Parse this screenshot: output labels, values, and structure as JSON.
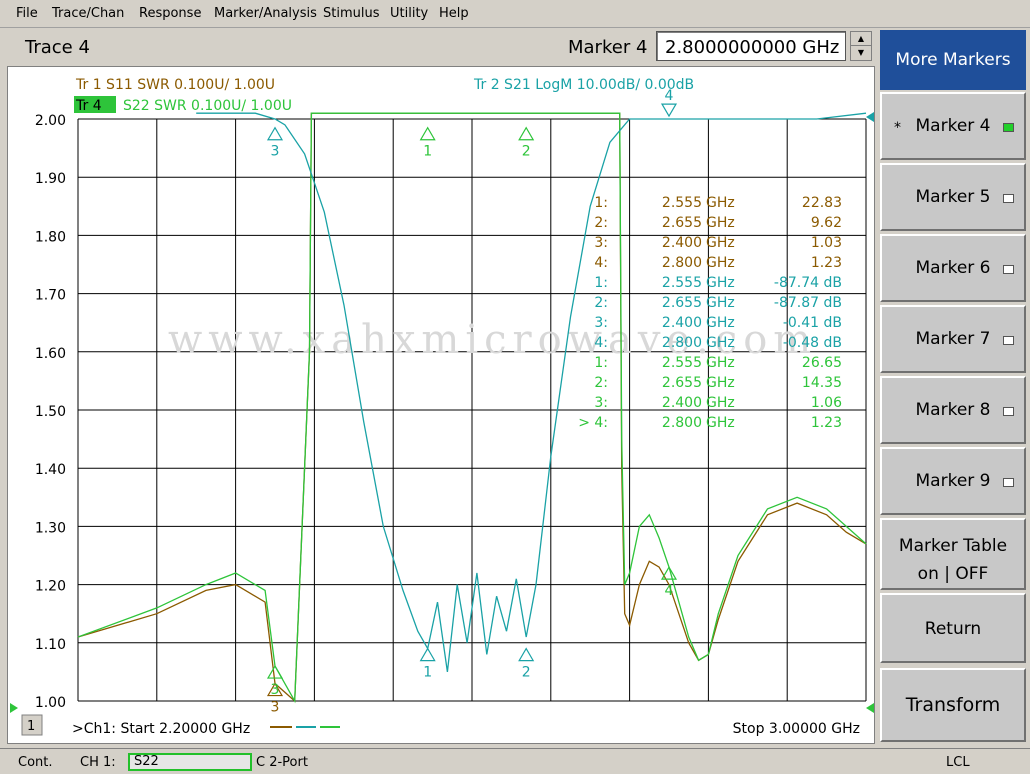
{
  "menu": [
    "File",
    "Trace/Chan",
    "Response",
    "Marker/Analysis",
    "Stimulus",
    "Utility",
    "Help"
  ],
  "header": {
    "trace_title": "Trace 4",
    "marker_label": "Marker 4",
    "marker_value": "2.8000000000 GHz"
  },
  "colors": {
    "s11": "#8b5a00",
    "s21": "#1aa2a6",
    "s22": "#2ec43a",
    "grid": "#000000",
    "active_softkey": "#1f4f9a"
  },
  "trace_labels": {
    "tr1": "Tr  1   S11 SWR 0.100U/  1.00U",
    "tr2": "Tr  2   S21 LogM 10.00dB/  0.00dB",
    "tr4_badge": "Tr  4",
    "tr4_text": "S22 SWR 0.100U/  1.00U"
  },
  "footer": {
    "channel_badge": "1",
    "start": ">Ch1: Start  2.20000 GHz",
    "stop": "Stop  3.00000 GHz"
  },
  "softkeys": [
    {
      "label": "More Markers",
      "active": true
    },
    {
      "label": "Marker 4",
      "star": "*",
      "led": "on"
    },
    {
      "label": "Marker 5",
      "led": "off"
    },
    {
      "label": "Marker 6",
      "led": "off"
    },
    {
      "label": "Marker 7",
      "led": "off"
    },
    {
      "label": "Marker 8",
      "led": "off"
    },
    {
      "label": "Marker 9",
      "led": "off"
    },
    {
      "label": "Marker Table",
      "label2": "on | OFF"
    },
    {
      "label": "Return"
    },
    {
      "label": "Transform"
    }
  ],
  "status": {
    "mode": "Cont.",
    "channel": "CH 1:",
    "param": "S22",
    "cal": "C  2-Port",
    "remote": "LCL"
  },
  "watermark": "www.xahxmicrowave.com",
  "chart_data": {
    "type": "line",
    "x_unit": "GHz",
    "xlim": [
      2.2,
      3.0
    ],
    "ylim": [
      1.0,
      2.0
    ],
    "y_ticks": [
      "2.00",
      "1.90",
      "1.80",
      "1.70",
      "1.60",
      "1.50",
      "1.40",
      "1.30",
      "1.20",
      "1.10",
      "1.00"
    ],
    "grid": true,
    "series": [
      {
        "key": "s11",
        "x": [
          2.2,
          2.28,
          2.33,
          2.36,
          2.39,
          2.4,
          2.42,
          2.435,
          2.437,
          2.75,
          2.752,
          2.755,
          2.76,
          2.77,
          2.78,
          2.79,
          2.8,
          2.82,
          2.83,
          2.84,
          2.85,
          2.87,
          2.9,
          2.93,
          2.96,
          2.98,
          3.0
        ],
        "y": [
          1.11,
          1.15,
          1.19,
          1.2,
          1.17,
          1.03,
          1.0,
          1.6,
          2.01,
          2.01,
          1.4,
          1.15,
          1.13,
          1.2,
          1.24,
          1.23,
          1.2,
          1.1,
          1.07,
          1.08,
          1.14,
          1.24,
          1.32,
          1.34,
          1.32,
          1.29,
          1.27
        ]
      },
      {
        "key": "s22",
        "x": [
          2.2,
          2.28,
          2.33,
          2.36,
          2.39,
          2.4,
          2.42,
          2.435,
          2.437,
          2.75,
          2.752,
          2.755,
          2.76,
          2.77,
          2.78,
          2.79,
          2.8,
          2.82,
          2.83,
          2.84,
          2.85,
          2.87,
          2.9,
          2.93,
          2.96,
          2.98,
          3.0
        ],
        "y": [
          1.11,
          1.16,
          1.2,
          1.22,
          1.19,
          1.06,
          1.0,
          1.6,
          2.01,
          2.01,
          1.45,
          1.2,
          1.22,
          1.3,
          1.32,
          1.28,
          1.23,
          1.11,
          1.07,
          1.08,
          1.15,
          1.25,
          1.33,
          1.35,
          1.33,
          1.3,
          1.27
        ]
      },
      {
        "key": "s21",
        "x": [
          2.32,
          2.35,
          2.38,
          2.4,
          2.41,
          2.43,
          2.45,
          2.47,
          2.49,
          2.51,
          2.53,
          2.545,
          2.555,
          2.565,
          2.575,
          2.585,
          2.595,
          2.605,
          2.615,
          2.625,
          2.635,
          2.645,
          2.655,
          2.665,
          2.68,
          2.7,
          2.72,
          2.74,
          2.76,
          2.78,
          2.8,
          2.85,
          2.9,
          2.95,
          3.0
        ],
        "y": [
          2.01,
          2.01,
          2.01,
          2.0,
          1.99,
          1.94,
          1.84,
          1.68,
          1.48,
          1.3,
          1.19,
          1.12,
          1.09,
          1.17,
          1.05,
          1.2,
          1.1,
          1.22,
          1.08,
          1.18,
          1.12,
          1.21,
          1.11,
          1.2,
          1.42,
          1.66,
          1.85,
          1.96,
          2.0,
          2.0,
          2.0,
          2.0,
          2.0,
          2.0,
          2.01
        ]
      }
    ],
    "markers_on_chart": [
      {
        "label": "3",
        "x": 2.4,
        "y": 1.985,
        "series": "s21"
      },
      {
        "label": "1",
        "x": 2.555,
        "y": 1.985,
        "series": "s22"
      },
      {
        "label": "2",
        "x": 2.655,
        "y": 1.985,
        "series": "s22"
      },
      {
        "label": "4",
        "x": 2.8,
        "y": 2.005,
        "series": "s21",
        "point_down": true
      },
      {
        "label": "3",
        "x": 2.4,
        "y": 1.03,
        "series": "s11"
      },
      {
        "label": "3",
        "x": 2.4,
        "y": 1.06,
        "series": "s22"
      },
      {
        "label": "1",
        "x": 2.555,
        "y": 1.09,
        "series": "s21"
      },
      {
        "label": "2",
        "x": 2.655,
        "y": 1.09,
        "series": "s21"
      },
      {
        "label": "4",
        "x": 2.8,
        "y": 1.23,
        "series": "s22"
      }
    ],
    "marker_table": [
      {
        "num": "1:",
        "freq": "2.555",
        "unit": "GHz",
        "value": "22.83",
        "series": "s11"
      },
      {
        "num": "2:",
        "freq": "2.655",
        "unit": "GHz",
        "value": "9.62",
        "series": "s11"
      },
      {
        "num": "3:",
        "freq": "2.400",
        "unit": "GHz",
        "value": "1.03",
        "series": "s11"
      },
      {
        "num": "4:",
        "freq": "2.800",
        "unit": "GHz",
        "value": "1.23",
        "series": "s11"
      },
      {
        "num": "1:",
        "freq": "2.555",
        "unit": "GHz",
        "value": "-87.74 dB",
        "series": "s21"
      },
      {
        "num": "2:",
        "freq": "2.655",
        "unit": "GHz",
        "value": "-87.87 dB",
        "series": "s21"
      },
      {
        "num": "3:",
        "freq": "2.400",
        "unit": "GHz",
        "value": "-0.41 dB",
        "series": "s21"
      },
      {
        "num": "4:",
        "freq": "2.800",
        "unit": "GHz",
        "value": "-0.48 dB",
        "series": "s21"
      },
      {
        "num": "1:",
        "freq": "2.555",
        "unit": "GHz",
        "value": "26.65",
        "series": "s22"
      },
      {
        "num": "2:",
        "freq": "2.655",
        "unit": "GHz",
        "value": "14.35",
        "series": "s22"
      },
      {
        "num": "3:",
        "freq": "2.400",
        "unit": "GHz",
        "value": "1.06",
        "series": "s22"
      },
      {
        "num": "> 4:",
        "freq": "2.800",
        "unit": "GHz",
        "value": "1.23",
        "series": "s22"
      }
    ]
  }
}
